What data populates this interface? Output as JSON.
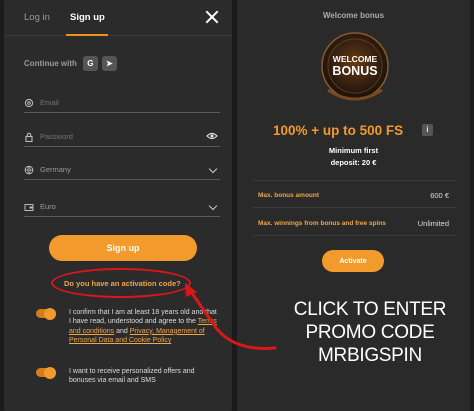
{
  "tabs": {
    "login": "Log in",
    "signup": "Sign up"
  },
  "continue_with": "Continue with",
  "social": {
    "google": "G",
    "telegram": "➤"
  },
  "fields": {
    "email": "Email",
    "password": "Password",
    "country": "Germany",
    "currency": "Euro"
  },
  "signup_button": "Sign up",
  "activation_link": "Do you have an activation code?",
  "consent": {
    "terms_prefix": "I confirm that I am at least 18 years old and that I have read, understood and agree to the",
    "terms_link": "Terms and conditions",
    "and": "and",
    "privacy_link": "Privacy, Management of Personal Data and Cookie Policy",
    "offers": "I want to receive personalized offers and bonuses via email and SMS"
  },
  "bonus": {
    "title": "Welcome bonus",
    "badge_line1": "WELCOME",
    "badge_line2": "BONUS",
    "headline": "100% + up to 500 FS",
    "info": "i",
    "min_label": "Minimum first",
    "min_value": "deposit: 20 €",
    "rows": [
      {
        "label": "Max. bonus amount",
        "value": "600 €"
      },
      {
        "label": "Max. winnings from bonus and free spins",
        "value": "Unlimited"
      }
    ],
    "activate": "Activate"
  },
  "overlay": {
    "line1": "CLICK TO ENTER",
    "line2": "PROMO CODE",
    "line3": "MRBIGSPIN"
  },
  "colors": {
    "accent": "#f39a2c",
    "annotation": "#d8171b",
    "panel": "#2b2b2b"
  }
}
